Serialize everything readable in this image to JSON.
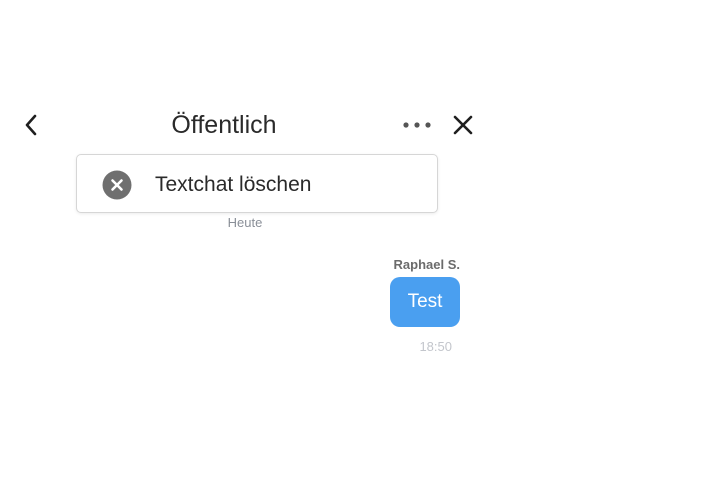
{
  "header": {
    "title": "Öffentlich",
    "back_icon": "chevron-left-icon",
    "more_icon": "more-horizontal-icon",
    "close_icon": "close-icon"
  },
  "menu": {
    "items": [
      {
        "icon": "clear-circle-icon",
        "label": "Textchat löschen"
      }
    ]
  },
  "chat": {
    "date_separator": "Heute",
    "messages": [
      {
        "sender": "Raphael S.",
        "text": "Test",
        "time": "18:50",
        "bubble_color": "#4a9ff0"
      }
    ]
  }
}
